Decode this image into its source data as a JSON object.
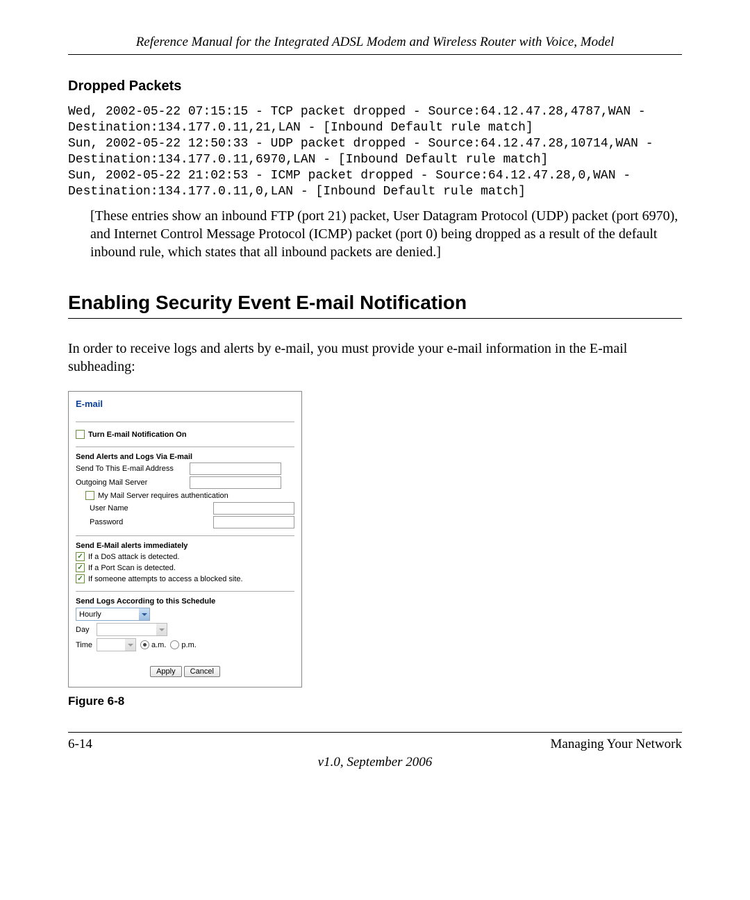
{
  "header": {
    "title": "Reference Manual for the Integrated ADSL Modem and Wireless Router with Voice, Model"
  },
  "dropped": {
    "heading": "Dropped Packets",
    "log": "Wed, 2002-05-22 07:15:15 - TCP packet dropped - Source:64.12.47.28,4787,WAN - Destination:134.177.0.11,21,LAN - [Inbound Default rule match]\nSun, 2002-05-22 12:50:33 - UDP packet dropped - Source:64.12.47.28,10714,WAN - Destination:134.177.0.11,6970,LAN - [Inbound Default rule match]\nSun, 2002-05-22 21:02:53 - ICMP packet dropped - Source:64.12.47.28,0,WAN - Destination:134.177.0.11,0,LAN - [Inbound Default rule match]",
    "explanation": "[These entries show an inbound FTP (port 21) packet, User Datagram Protocol (UDP) packet (port 6970), and Internet Control Message Protocol (ICMP) packet (port 0) being dropped as a result of the default inbound rule, which states that all inbound packets are denied.]"
  },
  "section": {
    "title": "Enabling Security Event E-mail Notification",
    "intro": "In order to receive logs and alerts by e-mail, you must provide your e-mail information in the E-mail subheading:"
  },
  "panel": {
    "title": "E-mail",
    "turn_on": "Turn E-mail Notification On",
    "send_via_heading": "Send Alerts and Logs Via E-mail",
    "send_to_label": "Send To This E-mail Address",
    "outgoing_label": "Outgoing Mail Server",
    "auth_label": "My Mail Server requires authentication",
    "username_label": "User Name",
    "password_label": "Password",
    "alerts_heading": "Send E-Mail alerts immediately",
    "dos_label": "If a DoS attack is detected.",
    "portscan_label": "If a Port Scan is detected.",
    "blocked_label": "If someone attempts to access a blocked site.",
    "schedule_heading": "Send Logs According to this Schedule",
    "schedule_value": "Hourly",
    "day_label": "Day",
    "time_label": "Time",
    "am_label": "a.m.",
    "pm_label": "p.m.",
    "apply": "Apply",
    "cancel": "Cancel"
  },
  "figure": {
    "caption": "Figure 6-8"
  },
  "footer": {
    "page": "6-14",
    "right": "Managing Your Network",
    "version": "v1.0, September 2006"
  }
}
